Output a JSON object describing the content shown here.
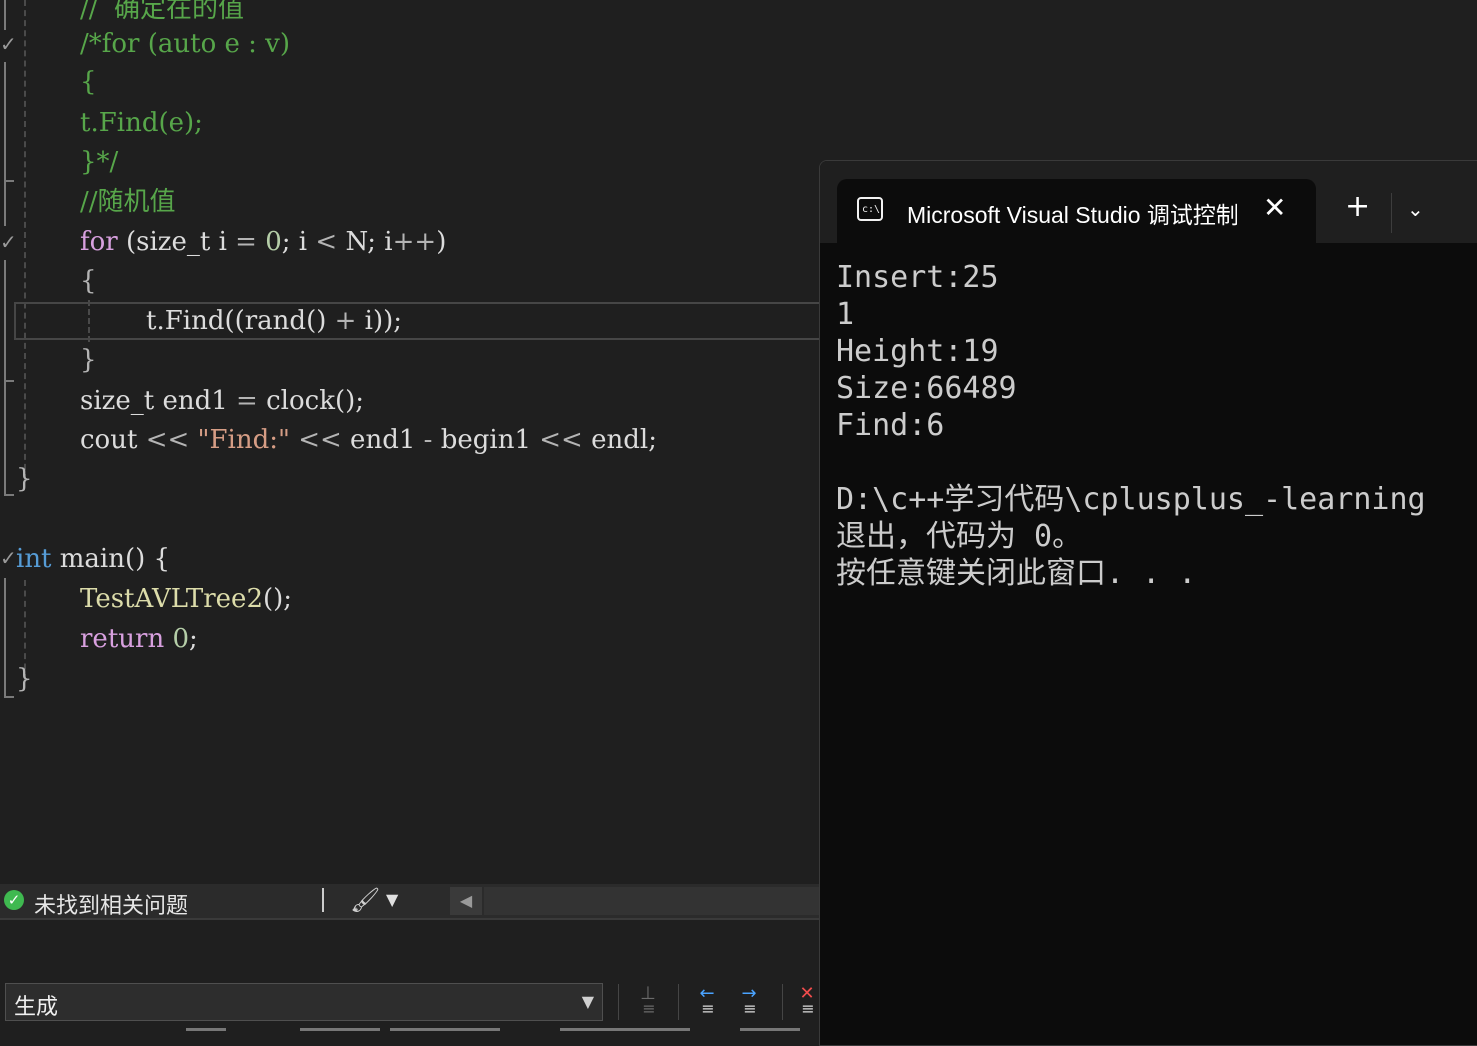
{
  "editor": {
    "lines": [
      {
        "tokens": [
          {
            "c": "cm",
            "t": "//  确定在的值"
          }
        ]
      },
      {
        "tokens": [
          {
            "c": "cm",
            "t": "/*for (auto e : v)"
          }
        ]
      },
      {
        "tokens": [
          {
            "c": "cm",
            "t": "{"
          }
        ]
      },
      {
        "tokens": [
          {
            "c": "cm",
            "t": "t.Find(e);"
          }
        ]
      },
      {
        "tokens": [
          {
            "c": "cm",
            "t": "}*/"
          }
        ]
      },
      {
        "tokens": [
          {
            "c": "cm",
            "t": "//随机值"
          }
        ]
      },
      {
        "tokens": [
          {
            "c": "kw2",
            "t": "for"
          },
          {
            "c": "plain",
            "t": " (size_t i "
          },
          {
            "c": "pun",
            "t": "="
          },
          {
            "c": "plain",
            "t": " "
          },
          {
            "c": "num",
            "t": "0"
          },
          {
            "c": "plain",
            "t": "; i "
          },
          {
            "c": "pun",
            "t": "<"
          },
          {
            "c": "plain",
            "t": " N; i"
          },
          {
            "c": "pun",
            "t": "++"
          },
          {
            "c": "plain",
            "t": ")"
          }
        ]
      },
      {
        "tokens": [
          {
            "c": "pun",
            "t": "{"
          }
        ]
      },
      {
        "tokens": [
          {
            "c": "plain",
            "t": "t.Find((rand() "
          },
          {
            "c": "pun",
            "t": "+"
          },
          {
            "c": "plain",
            "t": " i));"
          }
        ]
      },
      {
        "tokens": [
          {
            "c": "pun",
            "t": "}"
          }
        ]
      },
      {
        "tokens": [
          {
            "c": "plain",
            "t": "size_t end1 "
          },
          {
            "c": "pun",
            "t": "="
          },
          {
            "c": "plain",
            "t": " clock();"
          }
        ]
      },
      {
        "tokens": [
          {
            "c": "plain",
            "t": "cout "
          },
          {
            "c": "pun",
            "t": "<<"
          },
          {
            "c": "plain",
            "t": " "
          },
          {
            "c": "str",
            "t": "\"Find:\""
          },
          {
            "c": "plain",
            "t": " "
          },
          {
            "c": "pun",
            "t": "<<"
          },
          {
            "c": "plain",
            "t": " end1 "
          },
          {
            "c": "pun",
            "t": "-"
          },
          {
            "c": "plain",
            "t": " begin1 "
          },
          {
            "c": "pun",
            "t": "<<"
          },
          {
            "c": "plain",
            "t": " endl;"
          }
        ]
      },
      {
        "tokens": [
          {
            "c": "pun",
            "t": "}"
          }
        ]
      },
      {
        "tokens": []
      },
      {
        "tokens": [
          {
            "c": "kw",
            "t": "int"
          },
          {
            "c": "plain",
            "t": " main() {"
          }
        ]
      },
      {
        "tokens": [
          {
            "c": "fn",
            "t": "TestAVLTree2"
          },
          {
            "c": "plain",
            "t": "();"
          }
        ]
      },
      {
        "tokens": [
          {
            "c": "kw2",
            "t": "return"
          },
          {
            "c": "plain",
            "t": " "
          },
          {
            "c": "num",
            "t": "0"
          },
          {
            "c": "plain",
            "t": ";"
          }
        ]
      },
      {
        "tokens": [
          {
            "c": "pun",
            "t": "}"
          }
        ]
      }
    ]
  },
  "status": {
    "message": "未找到相关问题",
    "icons": {
      "ok": "check-circle-icon",
      "cleanup": "broom-icon",
      "dropdown": "chevron-down-icon",
      "scroll": "chevron-left-icon"
    }
  },
  "output": {
    "source_label": "生成"
  },
  "terminal": {
    "tab_title": "Microsoft Visual Studio 调试控制台",
    "icon_text": "c:\\",
    "lines": [
      "Insert:25",
      "1",
      "Height:19",
      "Size:66489",
      "Find:6",
      "",
      "D:\\c++学习代码\\cplusplus_-learning",
      "退出，代码为 0。",
      "按任意键关闭此窗口. . ."
    ]
  },
  "colors": {
    "editor_bg": "#1f1f1f",
    "terminal_bg": "#0c0c0c",
    "comment": "#57a64a",
    "keyword": "#569cd6",
    "control_keyword": "#d8a0df",
    "string": "#d69d85",
    "number": "#b5cea8",
    "function": "#dcdcaa"
  }
}
